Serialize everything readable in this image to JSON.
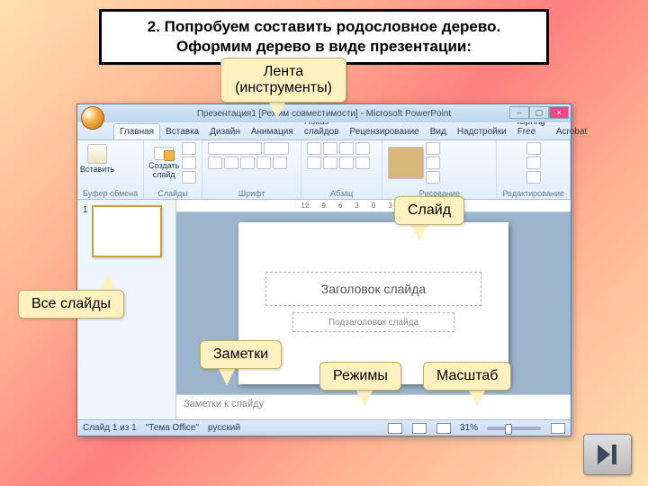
{
  "header": {
    "line1": "2. Попробуем составить родословное дерево.",
    "line2": "Оформим дерево в виде презентации:"
  },
  "callouts": {
    "ribbon": "Лента\n(инструменты)",
    "slide": "Слайд",
    "allSlides": "Все слайды",
    "notes": "Заметки",
    "views": "Режимы",
    "zoom": "Масштаб"
  },
  "pp": {
    "title": "Презентация1 [Режим совместимости] - Microsoft PowerPoint",
    "tabs": [
      "Главная",
      "Вставка",
      "Дизайн",
      "Анимация",
      "Показ слайдов",
      "Рецензирование",
      "Вид",
      "Надстройки",
      "iSpring Free",
      "Acrobat"
    ],
    "groups": {
      "clipboard": "Буфер обмена",
      "slides": "Слайды",
      "font": "Шрифт",
      "paragraph": "Абзац",
      "drawing": "Рисование",
      "editing": "Редактирование"
    },
    "buttons": {
      "paste": "Вставить",
      "newSlide": "Создать\nслайд"
    },
    "ruler": [
      "12",
      "9",
      "6",
      "3",
      "0",
      "3",
      "6",
      "9",
      "12"
    ],
    "placeholders": {
      "title": "Заголовок слайда",
      "subtitle": "Подзаголовок слайда"
    },
    "notesPlaceholder": "Заметки к слайду",
    "status": {
      "slide": "Слайд 1 из 1",
      "theme": "\"Тема Office\"",
      "lang": "русский",
      "zoom": "31%"
    }
  },
  "nav": {
    "next": "next-slide"
  }
}
